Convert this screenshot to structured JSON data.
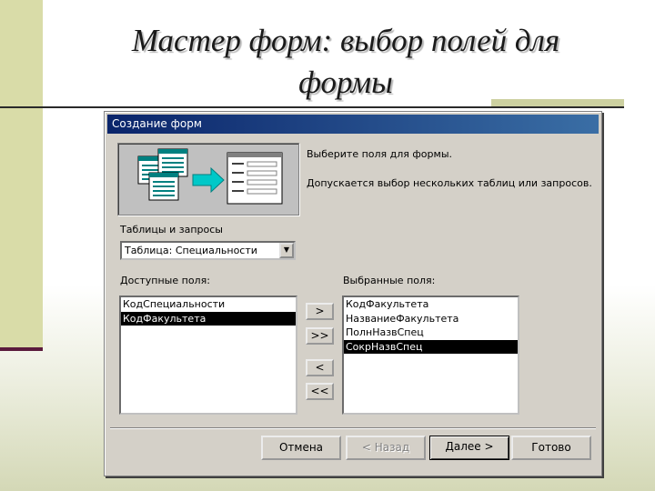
{
  "slide": {
    "title_line1": "Мастер форм: выбор полей для",
    "title_line2": "формы"
  },
  "dialog": {
    "title": "Создание форм",
    "instruction": "Выберите поля для формы.",
    "hint": "Допускается выбор нескольких таблиц или запросов.",
    "tables_label": "Таблицы и запросы",
    "table_selected": "Таблица: Специальности",
    "available_label": "Доступные поля:",
    "selected_label": "Выбранные поля:",
    "available_fields": [
      {
        "text": "КодСпециальности",
        "selected": false
      },
      {
        "text": "КодФакультета",
        "selected": true
      }
    ],
    "selected_fields": [
      {
        "text": "КодФакультета",
        "selected": false
      },
      {
        "text": "НазваниеФакультета",
        "selected": false
      },
      {
        "text": "ПолнНазвСпец",
        "selected": false
      },
      {
        "text": "СокрНазвСпец",
        "selected": true
      }
    ],
    "move_buttons": {
      "add_one": ">",
      "add_all": ">>",
      "remove_one": "<",
      "remove_all": "<<"
    },
    "buttons": {
      "cancel": "Отмена",
      "back": "< Назад",
      "next": "Далее >",
      "finish": "Готово"
    }
  },
  "colors": {
    "dialog_bg": "#d4d0c8",
    "title_bar": "#0a246a",
    "selection": "#000000",
    "slide_accent": "#d9dca8",
    "slide_bar": "#5a1a3c"
  },
  "icons": [
    "dropdown-arrow-icon",
    "tables-to-form-illustration"
  ]
}
